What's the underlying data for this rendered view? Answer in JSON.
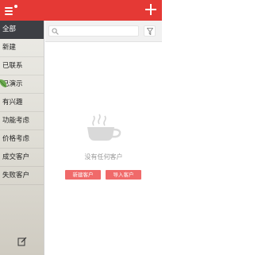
{
  "header": {
    "menu_icon": "hamburger-menu-icon",
    "add_icon": "plus-icon",
    "accent_color": "#e53935"
  },
  "sidebar": {
    "items": [
      {
        "label": "全部",
        "active": true
      },
      {
        "label": "新建"
      },
      {
        "label": "已联系"
      },
      {
        "label": "已演示"
      },
      {
        "label": "有兴趣"
      },
      {
        "label": "功能考虑"
      },
      {
        "label": "价格考虑"
      },
      {
        "label": "成交客户"
      },
      {
        "label": "失败客户"
      }
    ],
    "edit_icon": "edit-icon"
  },
  "search": {
    "placeholder": "",
    "search_icon": "search-icon",
    "filter_icon": "filter-icon"
  },
  "empty_state": {
    "icon": "coffee-cup-icon",
    "message": "没有任何客户",
    "new_button": "新建客户",
    "import_button": "导入客户",
    "button_color": "#f06a6a"
  }
}
